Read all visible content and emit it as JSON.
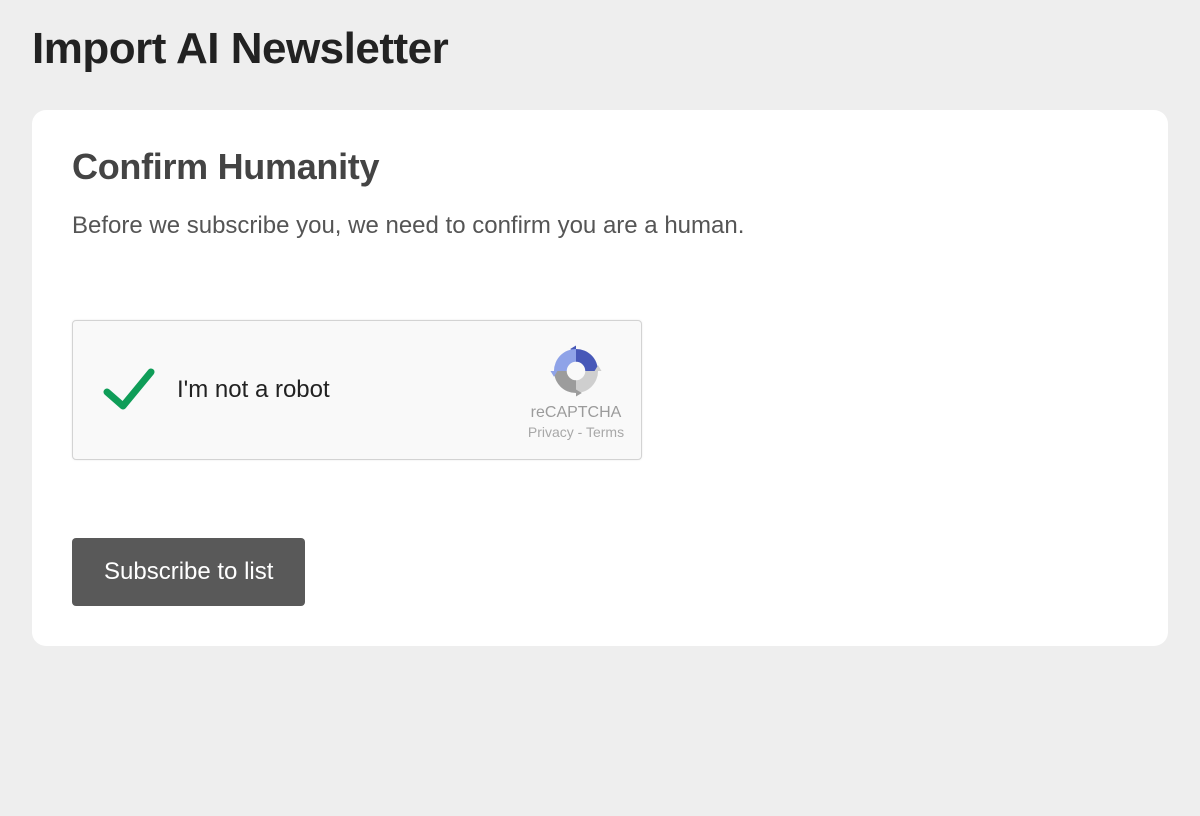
{
  "page": {
    "title": "Import AI Newsletter"
  },
  "card": {
    "heading": "Confirm Humanity",
    "description": "Before we subscribe you, we need to confirm you are a human."
  },
  "recaptcha": {
    "label": "I'm not a robot",
    "brand": "reCAPTCHA",
    "privacy_label": "Privacy",
    "separator": " - ",
    "terms_label": "Terms"
  },
  "actions": {
    "subscribe_label": "Subscribe to list"
  }
}
